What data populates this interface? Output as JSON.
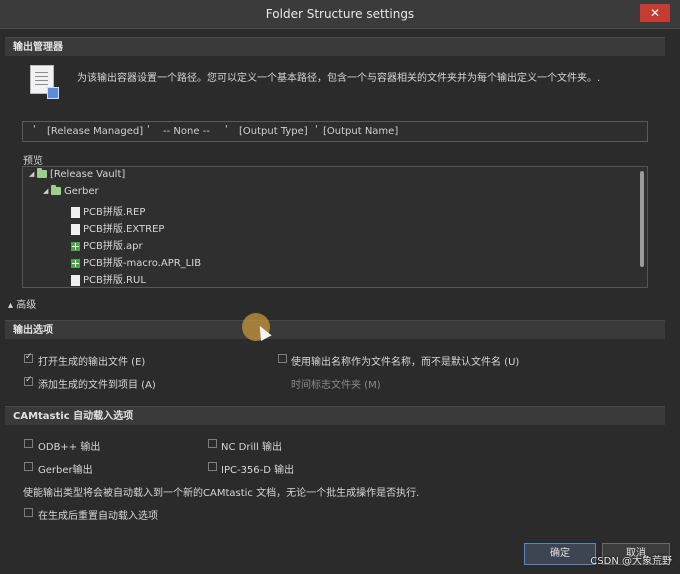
{
  "window": {
    "title": "Folder Structure settings",
    "close_label": "✕"
  },
  "output_manager": {
    "header": "输出管理器",
    "description": "为该输出容器设置一个路径。您可以定义一个基本路径，包含一个与容器相关的文件夹并为每个输出定义一个文件夹。.",
    "path_segments": [
      "[Release Managed]",
      "-- None --",
      "[Output Type]",
      "[Output Name]"
    ],
    "separator": "'"
  },
  "preview": {
    "label": "预览",
    "tree": [
      {
        "label": "[Release Vault]",
        "icon": "folder-icon",
        "level": 0,
        "expanded": true
      },
      {
        "label": "Gerber",
        "icon": "folder-icon",
        "level": 1,
        "expanded": true
      },
      {
        "label": "PCB拼版.REP",
        "icon": "file-icon",
        "level": 2
      },
      {
        "label": "PCB拼版.EXTREP",
        "icon": "file-icon",
        "level": 2
      },
      {
        "label": "PCB拼版.apr",
        "icon": "apr-file-icon",
        "level": 2
      },
      {
        "label": "PCB拼版-macro.APR_LIB",
        "icon": "apr-file-icon",
        "level": 2
      },
      {
        "label": "PCB拼版.RUL",
        "icon": "file-icon",
        "level": 2
      }
    ]
  },
  "advanced": {
    "label": "▴ 高级"
  },
  "output_options": {
    "header": "输出选项",
    "items": [
      {
        "label": "打开生成的输出文件 (E)",
        "checked": true,
        "enabled": true
      },
      {
        "label": "添加生成的文件到项目 (A)",
        "checked": true,
        "enabled": true
      },
      {
        "label": "使用输出名称作为文件名称，而不是默认文件名 (U)",
        "checked": false,
        "enabled": true
      },
      {
        "label": "时间标志文件夹 (M)",
        "checked": false,
        "enabled": false
      }
    ]
  },
  "camtastic": {
    "header": "CAMtastic 自动载入选项",
    "items": [
      {
        "label": "ODB++ 输出",
        "checked": false
      },
      {
        "label": "NC Drill 输出",
        "checked": false
      },
      {
        "label": "Gerber输出",
        "checked": false
      },
      {
        "label": "IPC-356-D 输出",
        "checked": false
      }
    ],
    "note": "使能输出类型将会被自动载入到一个新的CAMtastic 文档，无论一个批生成操作是否执行.",
    "reset_label": "在生成后重置自动载入选项"
  },
  "buttons": {
    "ok": "确定",
    "cancel": "取消"
  },
  "watermark": "CSDN @大象荒野"
}
